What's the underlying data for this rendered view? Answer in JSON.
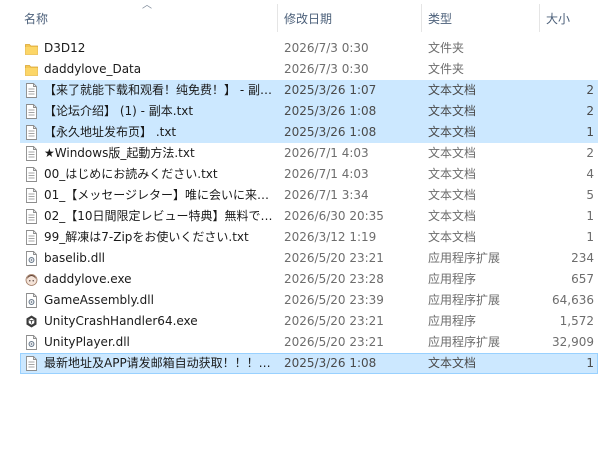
{
  "columns": {
    "name": "名称",
    "date": "修改日期",
    "type": "类型",
    "size": "大小"
  },
  "files": [
    {
      "name": "D3D12",
      "date": "2026/7/3 0:30",
      "type": "文件夹",
      "size": "",
      "icon": "folder-icon",
      "selected": false
    },
    {
      "name": "daddylove_Data",
      "date": "2026/7/3 0:30",
      "type": "文件夹",
      "size": "",
      "icon": "folder-icon",
      "selected": false
    },
    {
      "name": "【来了就能下载和观看！纯免费！】 - 副…",
      "date": "2025/3/26 1:07",
      "type": "文本文档",
      "size": "2",
      "icon": "text-file-icon",
      "selected": true
    },
    {
      "name": "【论坛介绍】 (1) - 副本.txt",
      "date": "2025/3/26 1:08",
      "type": "文本文档",
      "size": "2",
      "icon": "text-file-icon",
      "selected": true
    },
    {
      "name": "【永久地址发布页】 .txt",
      "date": "2025/3/26 1:08",
      "type": "文本文档",
      "size": "1",
      "icon": "text-file-icon",
      "selected": true
    },
    {
      "name": "★Windows版_起動方法.txt",
      "date": "2026/7/1 4:03",
      "type": "文本文档",
      "size": "2",
      "icon": "text-file-icon",
      "selected": false
    },
    {
      "name": "00_はじめにお読みください.txt",
      "date": "2026/7/1 4:03",
      "type": "文本文档",
      "size": "4",
      "icon": "text-file-icon",
      "selected": false
    },
    {
      "name": "01_【メッセージレター】唯に会いに来…",
      "date": "2026/7/1 3:34",
      "type": "文本文档",
      "size": "5",
      "icon": "text-file-icon",
      "selected": false
    },
    {
      "name": "02_【10日間限定レビュー特典】無料で…",
      "date": "2026/6/30 20:35",
      "type": "文本文档",
      "size": "1",
      "icon": "text-file-icon",
      "selected": false
    },
    {
      "name": "99_解凍は7-Zipをお使いください.txt",
      "date": "2026/3/12 1:19",
      "type": "文本文档",
      "size": "1",
      "icon": "text-file-icon",
      "selected": false
    },
    {
      "name": "baselib.dll",
      "date": "2026/5/20 23:21",
      "type": "应用程序扩展",
      "size": "234",
      "icon": "dll-file-icon",
      "selected": false
    },
    {
      "name": "daddylove.exe",
      "date": "2026/5/20 23:28",
      "type": "应用程序",
      "size": "657",
      "icon": "app-icon",
      "selected": false
    },
    {
      "name": "GameAssembly.dll",
      "date": "2026/5/20 23:39",
      "type": "应用程序扩展",
      "size": "64,636",
      "icon": "dll-file-icon",
      "selected": false
    },
    {
      "name": "UnityCrashHandler64.exe",
      "date": "2026/5/20 23:21",
      "type": "应用程序",
      "size": "1,572",
      "icon": "unity-icon",
      "selected": false
    },
    {
      "name": "UnityPlayer.dll",
      "date": "2026/5/20 23:21",
      "type": "应用程序扩展",
      "size": "32,909",
      "icon": "dll-file-icon",
      "selected": false
    },
    {
      "name": "最新地址及APP请发邮箱自动获取！！！…",
      "date": "2025/3/26 1:08",
      "type": "文本文档",
      "size": "1",
      "icon": "text-file-icon",
      "selected": true,
      "focused": true
    }
  ]
}
